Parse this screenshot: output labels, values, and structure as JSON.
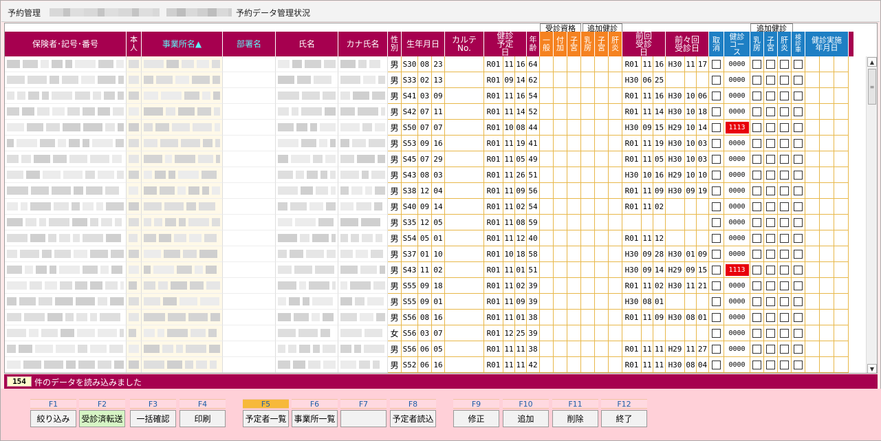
{
  "window": {
    "app_title": "予約管理",
    "form_title": "予約データ管理状況"
  },
  "header": {
    "groups": {
      "jushin_shikaku": "受診資格",
      "tsuika_kenshin_1": "追加健診",
      "tsuika_kenshin_2": "追加健診"
    },
    "columns": {
      "hokensha": "保険者･記号･番号",
      "honnin": "本人",
      "jigyosho": "事業所名▲",
      "busho": "部署名",
      "shimei": "氏名",
      "kana": "カナ氏名",
      "seibetsu": "性別",
      "seinengappi": "生年月日",
      "karte": "カルテNo.",
      "kenshin_yotei": "健診予定日",
      "nenrei": "年齢",
      "ippan": "一般",
      "fuka": "付加",
      "shikyu": "子宮",
      "nyubo": "乳房",
      "shikyu2": "子宮",
      "kanen": "肝炎",
      "zenkai": "前回受診日",
      "zenzenkai": "前々回受診日",
      "torikeshi": "取消",
      "course": "健診コース",
      "nyubo2": "乳房",
      "shikyu3": "子宮",
      "kanen2": "肝炎",
      "kenshinsha": "検診車",
      "jisshi": "健診実施年月日"
    }
  },
  "rows": [
    {
      "sex": "男",
      "birth": [
        "S30",
        "08",
        "23"
      ],
      "yotei": [
        "R01",
        "11",
        "16"
      ],
      "age": "64",
      "prev": [
        "R01",
        "11",
        "16"
      ],
      "prev2": [
        "H30",
        "11",
        "17"
      ],
      "course": "0000",
      "alert": false
    },
    {
      "sex": "男",
      "birth": [
        "S33",
        "02",
        "13"
      ],
      "yotei": [
        "R01",
        "09",
        "14"
      ],
      "age": "62",
      "prev": [
        "H30",
        "06",
        "25"
      ],
      "prev2": [
        "",
        "",
        ""
      ],
      "course": "0000",
      "alert": false
    },
    {
      "sex": "男",
      "birth": [
        "S41",
        "03",
        "09"
      ],
      "yotei": [
        "R01",
        "11",
        "16"
      ],
      "age": "54",
      "prev": [
        "R01",
        "11",
        "16"
      ],
      "prev2": [
        "H30",
        "10",
        "06"
      ],
      "course": "0000",
      "alert": false
    },
    {
      "sex": "男",
      "birth": [
        "S42",
        "07",
        "11"
      ],
      "yotei": [
        "R01",
        "11",
        "14"
      ],
      "age": "52",
      "prev": [
        "R01",
        "11",
        "14"
      ],
      "prev2": [
        "H30",
        "10",
        "18"
      ],
      "course": "0000",
      "alert": false
    },
    {
      "sex": "男",
      "birth": [
        "S50",
        "07",
        "07"
      ],
      "yotei": [
        "R01",
        "10",
        "08"
      ],
      "age": "44",
      "prev": [
        "H30",
        "09",
        "15"
      ],
      "prev2": [
        "H29",
        "10",
        "14"
      ],
      "course": "1113",
      "alert": true
    },
    {
      "sex": "男",
      "birth": [
        "S53",
        "09",
        "16"
      ],
      "yotei": [
        "R01",
        "11",
        "19"
      ],
      "age": "41",
      "prev": [
        "R01",
        "11",
        "19"
      ],
      "prev2": [
        "H30",
        "10",
        "03"
      ],
      "course": "0000",
      "alert": false
    },
    {
      "sex": "男",
      "birth": [
        "S45",
        "07",
        "29"
      ],
      "yotei": [
        "R01",
        "11",
        "05"
      ],
      "age": "49",
      "prev": [
        "R01",
        "11",
        "05"
      ],
      "prev2": [
        "H30",
        "10",
        "03"
      ],
      "course": "0000",
      "alert": false
    },
    {
      "sex": "男",
      "birth": [
        "S43",
        "08",
        "03"
      ],
      "yotei": [
        "R01",
        "11",
        "26"
      ],
      "age": "51",
      "prev": [
        "H30",
        "10",
        "16"
      ],
      "prev2": [
        "H29",
        "10",
        "10"
      ],
      "course": "0000",
      "alert": false
    },
    {
      "sex": "男",
      "birth": [
        "S38",
        "12",
        "04"
      ],
      "yotei": [
        "R01",
        "11",
        "09"
      ],
      "age": "56",
      "prev": [
        "R01",
        "11",
        "09"
      ],
      "prev2": [
        "H30",
        "09",
        "19"
      ],
      "course": "0000",
      "alert": false
    },
    {
      "sex": "男",
      "birth": [
        "S40",
        "09",
        "14"
      ],
      "yotei": [
        "R01",
        "11",
        "02"
      ],
      "age": "54",
      "prev": [
        "R01",
        "11",
        "02"
      ],
      "prev2": [
        "",
        "",
        ""
      ],
      "course": "0000",
      "alert": false
    },
    {
      "sex": "男",
      "birth": [
        "S35",
        "12",
        "05"
      ],
      "yotei": [
        "R01",
        "11",
        "08"
      ],
      "age": "59",
      "prev": [
        "",
        "",
        ""
      ],
      "prev2": [
        "",
        "",
        ""
      ],
      "course": "0000",
      "alert": false
    },
    {
      "sex": "男",
      "birth": [
        "S54",
        "05",
        "01"
      ],
      "yotei": [
        "R01",
        "11",
        "12"
      ],
      "age": "40",
      "prev": [
        "R01",
        "11",
        "12"
      ],
      "prev2": [
        "",
        "",
        ""
      ],
      "course": "0000",
      "alert": false
    },
    {
      "sex": "男",
      "birth": [
        "S37",
        "01",
        "10"
      ],
      "yotei": [
        "R01",
        "10",
        "18"
      ],
      "age": "58",
      "prev": [
        "H30",
        "09",
        "28"
      ],
      "prev2": [
        "H30",
        "01",
        "09"
      ],
      "course": "0000",
      "alert": false
    },
    {
      "sex": "男",
      "birth": [
        "S43",
        "11",
        "02"
      ],
      "yotei": [
        "R01",
        "11",
        "01"
      ],
      "age": "51",
      "prev": [
        "H30",
        "09",
        "14"
      ],
      "prev2": [
        "H29",
        "09",
        "15"
      ],
      "course": "1113",
      "alert": true
    },
    {
      "sex": "男",
      "birth": [
        "S55",
        "09",
        "18"
      ],
      "yotei": [
        "R01",
        "11",
        "02"
      ],
      "age": "39",
      "prev": [
        "R01",
        "11",
        "02"
      ],
      "prev2": [
        "H30",
        "11",
        "21"
      ],
      "course": "0000",
      "alert": false
    },
    {
      "sex": "男",
      "birth": [
        "S55",
        "09",
        "01"
      ],
      "yotei": [
        "R01",
        "11",
        "09"
      ],
      "age": "39",
      "prev": [
        "H30",
        "08",
        "01"
      ],
      "prev2": [
        "",
        "",
        ""
      ],
      "course": "0000",
      "alert": false
    },
    {
      "sex": "男",
      "birth": [
        "S56",
        "08",
        "16"
      ],
      "yotei": [
        "R01",
        "11",
        "01"
      ],
      "age": "38",
      "prev": [
        "R01",
        "11",
        "09"
      ],
      "prev2": [
        "H30",
        "08",
        "01"
      ],
      "course": "0000",
      "alert": false
    },
    {
      "sex": "女",
      "birth": [
        "S56",
        "03",
        "07"
      ],
      "yotei": [
        "R01",
        "12",
        "25"
      ],
      "age": "39",
      "prev": [
        "",
        "",
        ""
      ],
      "prev2": [
        "",
        "",
        ""
      ],
      "course": "0000",
      "alert": false
    },
    {
      "sex": "男",
      "birth": [
        "S56",
        "06",
        "05"
      ],
      "yotei": [
        "R01",
        "11",
        "11"
      ],
      "age": "38",
      "prev": [
        "R01",
        "11",
        "11"
      ],
      "prev2": [
        "H29",
        "11",
        "27"
      ],
      "course": "0000",
      "alert": false
    },
    {
      "sex": "男",
      "birth": [
        "S52",
        "06",
        "16"
      ],
      "yotei": [
        "R01",
        "11",
        "11"
      ],
      "age": "42",
      "prev": [
        "R01",
        "11",
        "11"
      ],
      "prev2": [
        "H30",
        "08",
        "04"
      ],
      "course": "0000",
      "alert": false
    }
  ],
  "status": {
    "count": "154",
    "message": "件のデータを読み込みました"
  },
  "fkeys": [
    {
      "key": "F1",
      "label": "絞り込み",
      "highlight": false,
      "green": false
    },
    {
      "key": "F2",
      "label": "受診済転送",
      "highlight": false,
      "green": true
    },
    {
      "key": "F3",
      "label": "一括確認",
      "highlight": false,
      "green": false
    },
    {
      "key": "F4",
      "label": "印刷",
      "highlight": false,
      "green": false
    },
    {
      "key": "F5",
      "label": "予定者一覧",
      "highlight": true,
      "green": false
    },
    {
      "key": "F6",
      "label": "事業所一覧",
      "highlight": false,
      "green": false
    },
    {
      "key": "F7",
      "label": "",
      "highlight": false,
      "green": false
    },
    {
      "key": "F8",
      "label": "予定者読込",
      "highlight": false,
      "green": false
    },
    {
      "key": "F9",
      "label": "修正",
      "highlight": false,
      "green": false
    },
    {
      "key": "F10",
      "label": "追加",
      "highlight": false,
      "green": false
    },
    {
      "key": "F11",
      "label": "削除",
      "highlight": false,
      "green": false
    },
    {
      "key": "F12",
      "label": "終了",
      "highlight": false,
      "green": false
    }
  ],
  "colors": {
    "header_bg": "#a6004f",
    "orange": "#f58220",
    "blue": "#1e7fc4",
    "alert_red": "#e8000b"
  }
}
